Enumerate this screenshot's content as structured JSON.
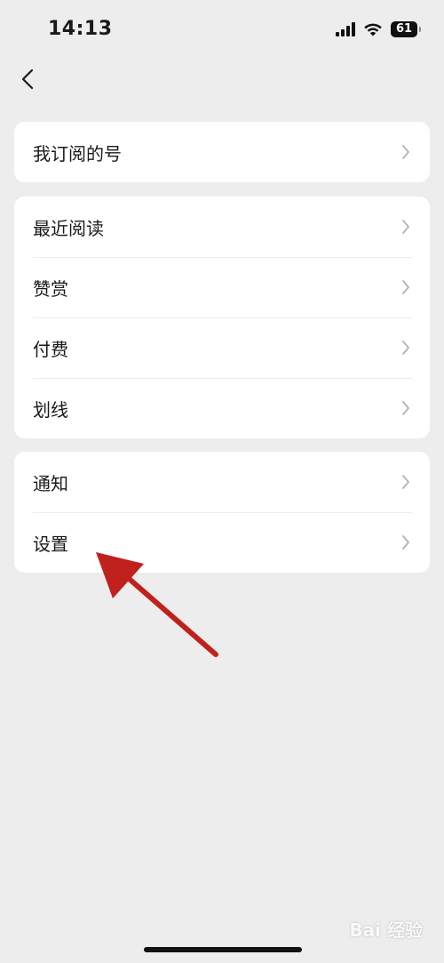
{
  "status_bar": {
    "time": "14:13",
    "battery": "61"
  },
  "navigation": {
    "back_icon": "chevron-left-icon"
  },
  "groups": [
    {
      "items": [
        {
          "label": "我订阅的号"
        }
      ]
    },
    {
      "items": [
        {
          "label": "最近阅读"
        },
        {
          "label": "赞赏"
        },
        {
          "label": "付费"
        },
        {
          "label": "划线"
        }
      ]
    },
    {
      "items": [
        {
          "label": "通知"
        },
        {
          "label": "设置"
        }
      ]
    }
  ],
  "annotation": {
    "color": "#c0211c"
  },
  "watermark": {
    "text": "Bai 经验"
  }
}
